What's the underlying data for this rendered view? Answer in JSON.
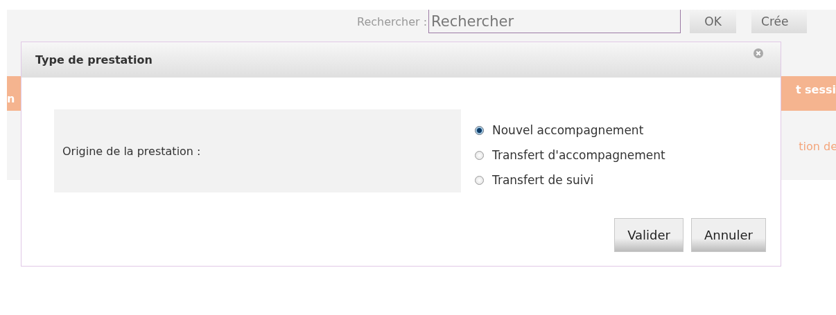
{
  "search": {
    "label": "Rechercher :",
    "placeholder": "Rechercher",
    "button": "OK"
  },
  "create_button": "Crée",
  "banner": {
    "left_text": "n",
    "right_text": "t sessi"
  },
  "link_text": "tion de",
  "dialog": {
    "title": "Type de prestation",
    "field_label": "Origine de la prestation :",
    "options": [
      {
        "label": "Nouvel accompagnement",
        "selected": true
      },
      {
        "label": "Transfert d'accompagnement",
        "selected": false
      },
      {
        "label": "Transfert de suivi",
        "selected": false
      }
    ],
    "buttons": [
      "Valider",
      "Annuler"
    ]
  }
}
